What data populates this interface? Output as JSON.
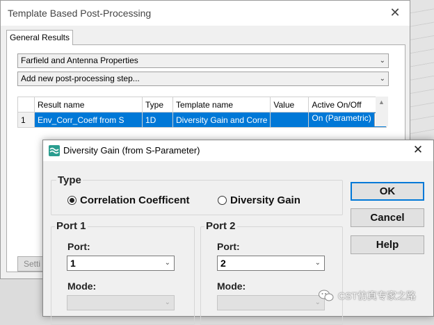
{
  "background_window": {
    "title": "Template Based Post-Processing",
    "tabs": [
      {
        "label": "General Results"
      }
    ],
    "result_category": "Farfield and Antenna Properties",
    "add_step": "Add new post-processing step...",
    "grid": {
      "headers": [
        "",
        "Result name",
        "Type",
        "Template name",
        "Value",
        "Active On/Off"
      ],
      "rows": [
        {
          "row_number": "1",
          "result_name": "Env_Corr_Coeff from S",
          "type": "1D",
          "template_name": "Diversity Gain and Corre",
          "value": "",
          "active": "On (Parametric)"
        }
      ]
    },
    "partial_button": "Setti"
  },
  "dialog": {
    "title": "Diversity Gain (from S-Parameter)",
    "type_group": {
      "title": "Type",
      "options": [
        {
          "label": "Correlation Coefficent",
          "selected": true
        },
        {
          "label": "Diversity Gain",
          "selected": false
        }
      ]
    },
    "port1": {
      "title": "Port 1",
      "port_label": "Port:",
      "port_value": "1",
      "mode_label": "Mode:",
      "mode_value": ""
    },
    "port2": {
      "title": "Port 2",
      "port_label": "Port:",
      "port_value": "2",
      "mode_label": "Mode:",
      "mode_value": ""
    },
    "buttons": {
      "ok": "OK",
      "cancel": "Cancel",
      "help": "Help"
    }
  },
  "watermark": "CST仿真专家之路",
  "colors": {
    "selection": "#0078d7",
    "default_button_border": "#0078d7",
    "dialog_icon": "#2a9d8f"
  }
}
